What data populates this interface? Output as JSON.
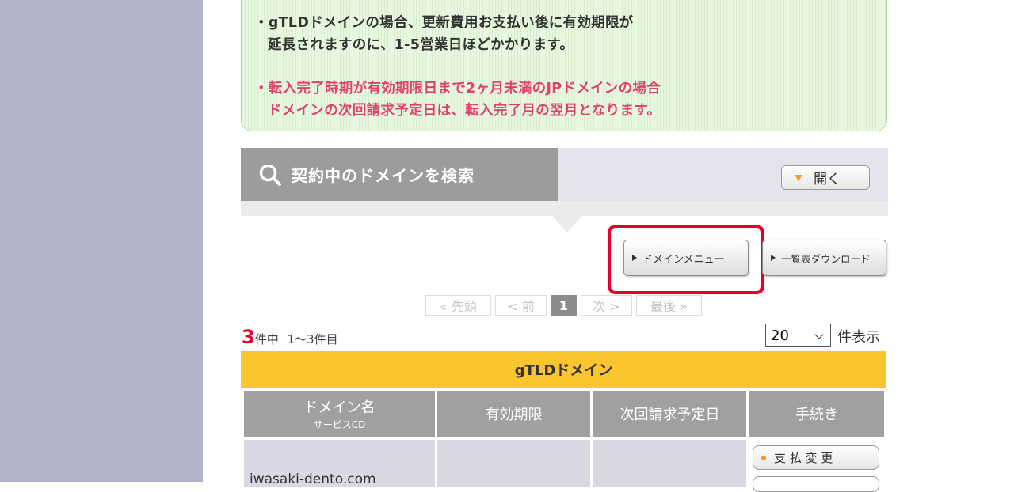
{
  "notice": {
    "line1": "・gTLDドメインの場合、更新費用お支払い後に有効期限が",
    "line2": "延長されますのに、1-5営業日ほどかかります。",
    "line3": "・転入完了時期が有効期限日まで2ヶ月未満のJPドメインの場合",
    "line4": "ドメインの次回請求予定日は、転入完了月の翌月となります。",
    "accent_color": "#e0416b"
  },
  "search": {
    "title": "契約中のドメインを検索",
    "toggle_label": "開く"
  },
  "actions": {
    "domain_menu": "ドメインメニュー",
    "download_list": "一覧表ダウンロード"
  },
  "pager": {
    "first": "« 先頭",
    "prev": "< 前",
    "current": "1",
    "next": "次 >",
    "last": "最後 »"
  },
  "results": {
    "count": "3",
    "count_suffix": "件中",
    "range": "1〜3件目",
    "per_page_value": "20",
    "per_page_label": "件表示"
  },
  "table": {
    "title": "gTLDドメイン",
    "columns": {
      "domain": "ドメイン名",
      "domain_sub": "サービスCD",
      "expiry": "有効期限",
      "next_billing": "次回請求予定日",
      "procedure": "手続き"
    },
    "rows": [
      {
        "domain": "iwasaki-dento.com",
        "action": "支 払 変 更"
      }
    ]
  }
}
